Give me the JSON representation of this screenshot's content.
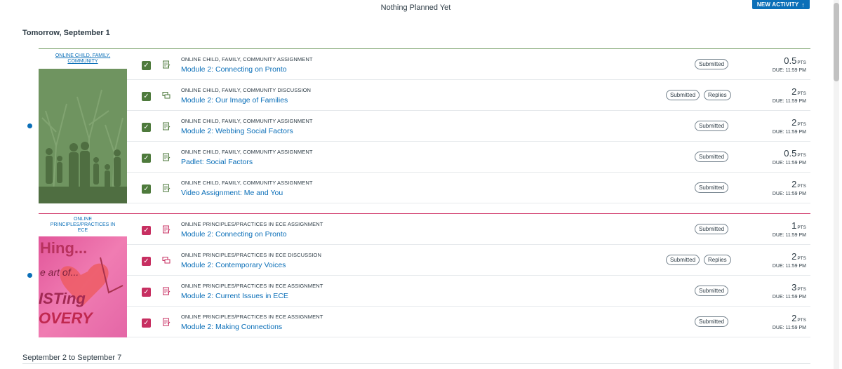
{
  "header": {
    "status_text": "Nothing Planned Yet",
    "new_activity_label": "NEW ACTIVITY",
    "new_activity_icon": "arrow-up-icon"
  },
  "days": {
    "tomorrow": "Tomorrow, September 1",
    "next_range": "September 2 to September 7"
  },
  "courses": [
    {
      "name": "ONLINE CHILD, FAMILY, COMMUNITY",
      "color": "#4e7a3c",
      "items": [
        {
          "course_label": "ONLINE CHILD, FAMILY, COMMUNITY ASSIGNMENT",
          "title": "Module 2: Connecting on Pronto",
          "type": "assignment",
          "pills": [
            "Submitted"
          ],
          "points": "0.5",
          "unit": "PTS",
          "due": "DUE: 11:59 PM"
        },
        {
          "course_label": "ONLINE CHILD, FAMILY, COMMUNITY DISCUSSION",
          "title": "Module 2: Our Image of Families",
          "type": "discussion",
          "pills": [
            "Submitted",
            "Replies"
          ],
          "points": "2",
          "unit": "PTS",
          "due": "DUE: 11:59 PM"
        },
        {
          "course_label": "ONLINE CHILD, FAMILY, COMMUNITY ASSIGNMENT",
          "title": "Module 2: Webbing Social Factors",
          "type": "assignment",
          "pills": [
            "Submitted"
          ],
          "points": "2",
          "unit": "PTS",
          "due": "DUE: 11:59 PM"
        },
        {
          "course_label": "ONLINE CHILD, FAMILY, COMMUNITY ASSIGNMENT",
          "title": "Padlet: Social Factors",
          "type": "assignment",
          "pills": [
            "Submitted"
          ],
          "points": "0.5",
          "unit": "PTS",
          "due": "DUE: 11:59 PM"
        },
        {
          "course_label": "ONLINE CHILD, FAMILY, COMMUNITY ASSIGNMENT",
          "title": "Video Assignment: Me and You",
          "type": "assignment",
          "pills": [
            "Submitted"
          ],
          "points": "2",
          "unit": "PTS",
          "due": "DUE: 11:59 PM"
        }
      ]
    },
    {
      "name": "ONLINE PRINCIPLES/PRACTICES IN ECE",
      "color": "#c72f61",
      "image_text": [
        "Hing...",
        "e art of...",
        "ISTing",
        "OVERY"
      ],
      "items": [
        {
          "course_label": "ONLINE PRINCIPLES/PRACTICES IN ECE ASSIGNMENT",
          "title": "Module 2: Connecting on Pronto",
          "type": "assignment",
          "pills": [
            "Submitted"
          ],
          "points": "1",
          "unit": "PTS",
          "due": "DUE: 11:59 PM"
        },
        {
          "course_label": "ONLINE PRINCIPLES/PRACTICES IN ECE DISCUSSION",
          "title": "Module 2: Contemporary Voices",
          "type": "discussion",
          "pills": [
            "Submitted",
            "Replies"
          ],
          "points": "2",
          "unit": "PTS",
          "due": "DUE: 11:59 PM"
        },
        {
          "course_label": "ONLINE PRINCIPLES/PRACTICES IN ECE ASSIGNMENT",
          "title": "Module 2: Current Issues in ECE",
          "type": "assignment",
          "pills": [
            "Submitted"
          ],
          "points": "3",
          "unit": "PTS",
          "due": "DUE: 11:59 PM"
        },
        {
          "course_label": "ONLINE PRINCIPLES/PRACTICES IN ECE ASSIGNMENT",
          "title": "Module 2: Making Connections",
          "type": "assignment",
          "pills": [
            "Submitted"
          ],
          "points": "2",
          "unit": "PTS",
          "due": "DUE: 11:59 PM"
        }
      ]
    }
  ]
}
